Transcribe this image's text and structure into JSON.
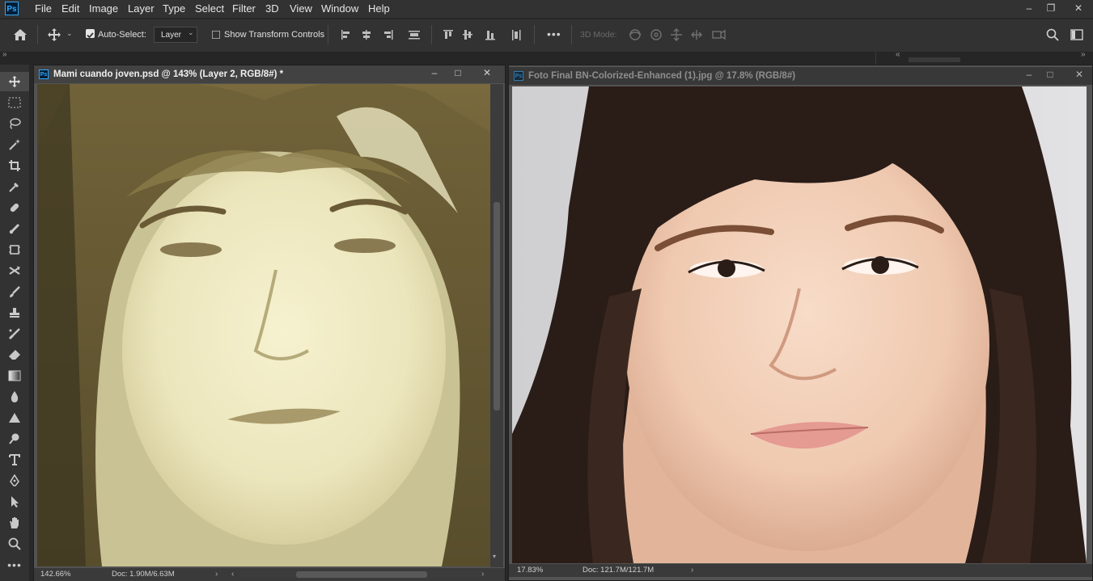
{
  "app": {
    "logo_text": "Ps"
  },
  "menu": [
    "File",
    "Edit",
    "Image",
    "Layer",
    "Type",
    "Select",
    "Filter",
    "3D",
    "View",
    "Window",
    "Help"
  ],
  "window_controls": [
    "–",
    "❐",
    "✕"
  ],
  "options": {
    "auto_select_label": "Auto-Select:",
    "auto_select_checked": true,
    "layer_select_value": "Layer",
    "transform_label": "Show Transform Controls",
    "mode_3d_label": "3D Mode:",
    "more_label": "•••"
  },
  "doc1": {
    "title": "Mami cuando joven.psd @ 143% (Layer 2, RGB/8#) *",
    "zoom": "142.66%",
    "doc_info": "Doc: 1.90M/6.63M",
    "controls": [
      "–",
      "□",
      "✕"
    ]
  },
  "doc2": {
    "title": "Foto Final BN-Colorized-Enhanced (1).jpg @ 17.8% (RGB/8#)",
    "zoom": "17.83%",
    "doc_info": "Doc: 121.7M/121.7M",
    "controls": [
      "–",
      "□",
      "✕"
    ]
  },
  "colors": {
    "ui_dark": "#323232",
    "canvas_bg": "#535353",
    "ps_blue": "#31a8ff"
  }
}
